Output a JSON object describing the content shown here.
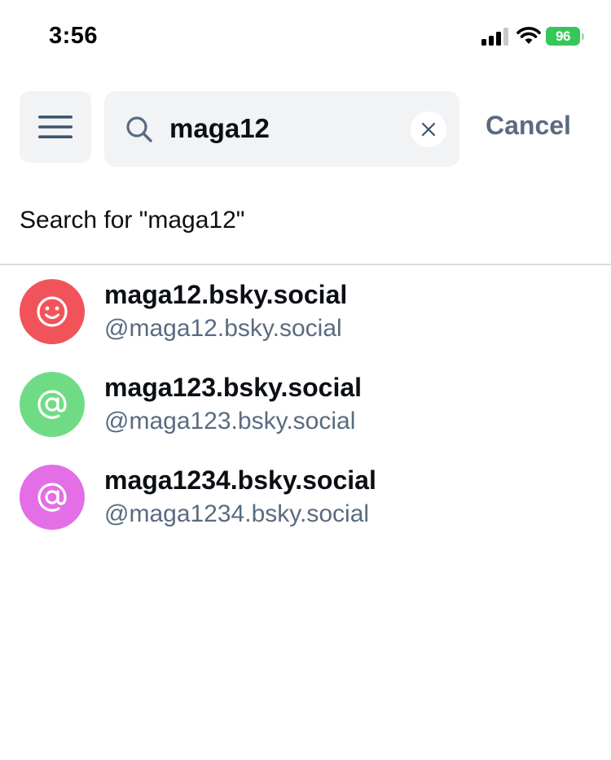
{
  "status_bar": {
    "time": "3:56",
    "battery_level": "96",
    "battery_color": "#35c759"
  },
  "header": {
    "menu_icon": "hamburger-menu-icon",
    "search": {
      "icon": "search-icon",
      "value": "maga12",
      "clear_icon": "close-icon"
    },
    "cancel_label": "Cancel"
  },
  "search_for": {
    "label": "Search for \"maga12\""
  },
  "results": [
    {
      "name": "maga12.bsky.social",
      "handle": "@maga12.bsky.social",
      "avatar_icon": "smiley-icon",
      "avatar_color": "#f0545a"
    },
    {
      "name": "maga123.bsky.social",
      "handle": "@maga123.bsky.social",
      "avatar_icon": "at-sign-icon",
      "avatar_color": "#6fdc85"
    },
    {
      "name": "maga1234.bsky.social",
      "handle": "@maga1234.bsky.social",
      "avatar_icon": "at-sign-icon",
      "avatar_color": "#e36ee6"
    }
  ],
  "colors": {
    "accent_text": "#5a6b80",
    "surface": "#f1f3f5"
  }
}
